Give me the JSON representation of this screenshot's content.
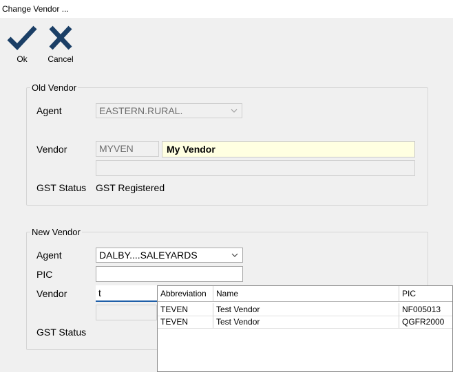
{
  "window": {
    "title": "Change Vendor ..."
  },
  "toolbar": {
    "ok_label": "Ok",
    "cancel_label": "Cancel"
  },
  "old_vendor": {
    "legend": "Old Vendor",
    "agent_label": "Agent",
    "agent_value": "EASTERN.RURAL.",
    "vendor_label": "Vendor",
    "vendor_code": "MYVEN",
    "vendor_name": "My Vendor",
    "gst_label": "GST Status",
    "gst_value": "GST Registered"
  },
  "new_vendor": {
    "legend": "New Vendor",
    "agent_label": "Agent",
    "agent_value": "DALBY....SALEYARDS",
    "pic_label": "PIC",
    "pic_value": "",
    "vendor_label": "Vendor",
    "vendor_input": "t",
    "gst_label": "GST Status"
  },
  "lookup": {
    "columns": [
      "Abbreviation",
      "Name",
      "PIC"
    ],
    "rows": [
      [
        "TEVEN",
        "Test Vendor",
        "NF005013"
      ],
      [
        "TEVEN",
        "Test Vendor",
        "QGFR2000"
      ]
    ]
  },
  "colors": {
    "check": "#1b3f66",
    "cancel": "#1b3f66",
    "highlight": "#ffffe1",
    "focus_underline": "#1f5fa8"
  }
}
